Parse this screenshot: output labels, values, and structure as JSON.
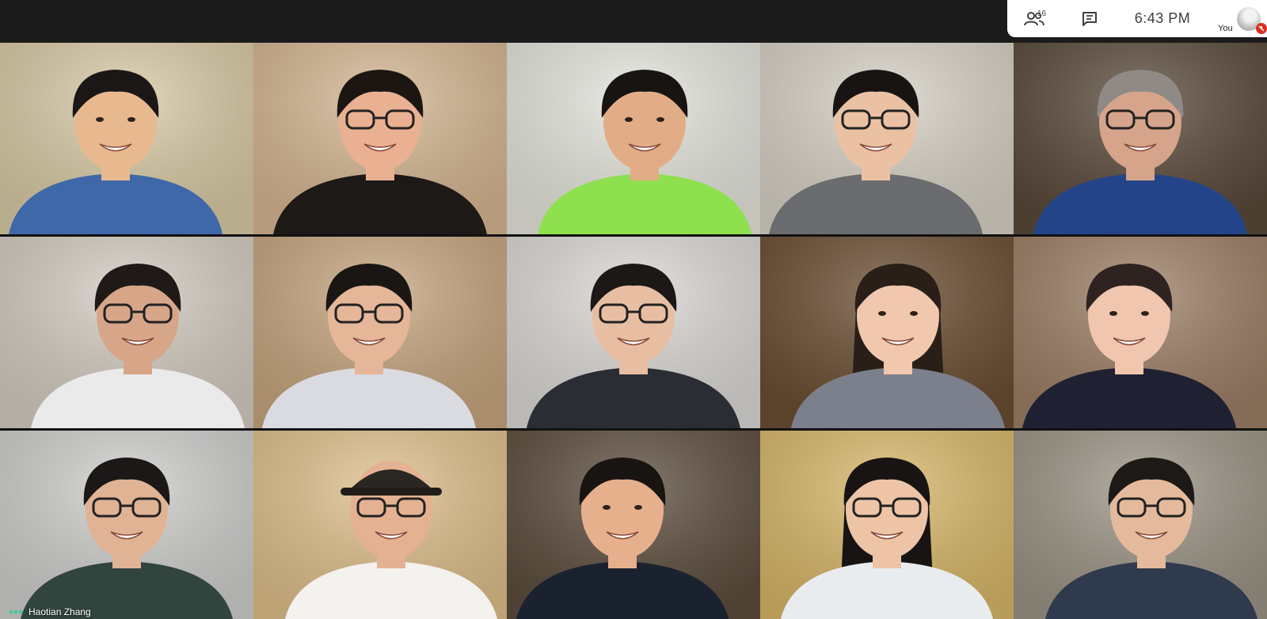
{
  "top_panel": {
    "participant_count": "16",
    "clock": "6:43  PM",
    "self_label": "You"
  },
  "tiles": [
    {
      "name": "",
      "bg": "#d9cba6",
      "skin": "#e8b98f",
      "hair": "#1a1716",
      "shirt": "#3f68a8",
      "glasses": false,
      "hat": false,
      "long_hair": false
    },
    {
      "name": "",
      "bg": "#d6b792",
      "skin": "#e9b091",
      "hair": "#1c1613",
      "shirt": "#1d1917",
      "glasses": true,
      "hat": false,
      "long_hair": false
    },
    {
      "name": "",
      "bg": "#e6e6de",
      "skin": "#e2ad86",
      "hair": "#171412",
      "shirt": "#8ee04e",
      "glasses": false,
      "hat": false,
      "long_hair": false
    },
    {
      "name": "",
      "bg": "#d8d2c6",
      "skin": "#ebc1a4",
      "hair": "#171412",
      "shirt": "#6a6c6f",
      "glasses": true,
      "hat": false,
      "long_hair": false
    },
    {
      "name": "",
      "bg": "#5a4a3b",
      "skin": "#d5a48a",
      "hair": "#8f8a85",
      "shirt": "#24448a",
      "glasses": true,
      "hat": false,
      "long_hair": false
    },
    {
      "name": "",
      "bg": "#d4cdc2",
      "skin": "#d7a688",
      "hair": "#1f1a17",
      "shirt": "#ebeaea",
      "glasses": true,
      "hat": false,
      "long_hair": false
    },
    {
      "name": "",
      "bg": "#c7a67f",
      "skin": "#e6b699",
      "hair": "#1a1614",
      "shirt": "#d9dbe0",
      "glasses": true,
      "hat": false,
      "long_hair": false
    },
    {
      "name": "",
      "bg": "#dcdad7",
      "skin": "#e8bea3",
      "hair": "#1b1816",
      "shirt": "#2a2d33",
      "glasses": true,
      "hat": false,
      "long_hair": false
    },
    {
      "name": "",
      "bg": "#6b4e32",
      "skin": "#f1c8ae",
      "hair": "#2a1f18",
      "shirt": "#7c7f8c",
      "glasses": false,
      "hat": false,
      "long_hair": true
    },
    {
      "name": "",
      "bg": "#9d7f66",
      "skin": "#f0c6ae",
      "hair": "#2e2320",
      "shirt": "#1f2133",
      "glasses": false,
      "hat": false,
      "long_hair": false
    },
    {
      "name": "Haotian Zhang",
      "bg": "#cfcfcd",
      "skin": "#e0b394",
      "hair": "#1b1817",
      "shirt": "#31443e",
      "glasses": true,
      "hat": false,
      "long_hair": false,
      "speaking": true
    },
    {
      "name": "",
      "bg": "#dfc08c",
      "skin": "#e4b292",
      "hair": "#1a1614",
      "shirt": "#f4f2ee",
      "glasses": true,
      "hat": true,
      "long_hair": false
    },
    {
      "name": "",
      "bg": "#5d4e3e",
      "skin": "#e7b08c",
      "hair": "#181412",
      "shirt": "#1a2230",
      "glasses": false,
      "hat": false,
      "long_hair": false
    },
    {
      "name": "",
      "bg": "#d9b86a",
      "skin": "#edc4a6",
      "hair": "#171413",
      "shirt": "#e9ecef",
      "glasses": true,
      "hat": false,
      "long_hair": true
    },
    {
      "name": "",
      "bg": "#9c9486",
      "skin": "#e5ba9c",
      "hair": "#1c1917",
      "shirt": "#2f3a4e",
      "glasses": true,
      "hat": false,
      "long_hair": false
    }
  ]
}
